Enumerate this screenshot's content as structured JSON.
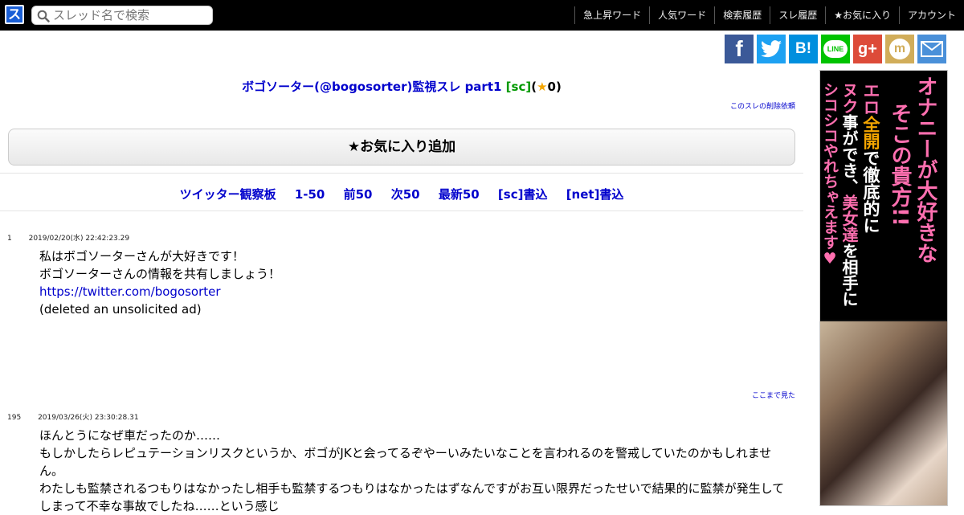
{
  "header": {
    "logo_text": "ス",
    "search_placeholder": "スレッド名で検索",
    "nav": [
      "急上昇ワード",
      "人気ワード",
      "検索履歴",
      "スレ履歴",
      "★お気に入り",
      "アカウント"
    ]
  },
  "share": {
    "icons": [
      "facebook-icon",
      "twitter-icon",
      "hatena-bookmark-icon",
      "line-icon",
      "google-plus-icon",
      "mixi-icon",
      "mail-icon"
    ],
    "labels": {
      "facebook": "f",
      "hatena": "B!",
      "line": "LINE",
      "google": "g+",
      "mixi": "m"
    },
    "colors": [
      "#3b5998",
      "#1da1f2",
      "#008fde",
      "#00c300",
      "#dd4b39",
      "#d1ad5a",
      "#4a90d9"
    ]
  },
  "thread": {
    "title": "ボゴソーター(@bogosorter)監視スレ part1",
    "sc_tag": "[sc]",
    "fav_open": "(",
    "fav_star": "★",
    "fav_count": "0)",
    "delete_request": "このスレの削除依頼",
    "favorite_button": "★お気に入り追加"
  },
  "navlinks": [
    "ツイッター観察板",
    "1-50",
    "前50",
    "次50",
    "最新50",
    "[sc]書込",
    "[net]書込"
  ],
  "posts": [
    {
      "num": "1",
      "datetime": "2019/02/20(水) 22:42:23.29",
      "lines": [
        "私はボゴソーターさんが大好きです！",
        "ボゴソーターさんの情報を共有しましょう！"
      ],
      "link": "https://twitter.com/bogosorter",
      "tail": "(deleted an unsolicited ad)"
    },
    {
      "num": "195",
      "datetime": "2019/03/26(火) 23:30:28.31",
      "lines": [
        "ほんとうになぜ車だったのか……",
        "もしかしたらレピュテーションリスクというか、ボゴがJKと会ってるぞやーいみたいなことを言われるのを警戒していたのかもしれません。",
        "わたしも監禁されるつもりはなかったし相手も監禁するつもりはなかったはずなんですがお互い限界だったせいで結果的に監禁が発生してしまって不幸な事故でしたね……という感じ"
      ]
    }
  ],
  "seen_here": "ここまで見た",
  "ad": {
    "col1": "オナニーが大好きな",
    "col2": "そこの貴方!!",
    "col3_a": "エロ",
    "col3_b": "全開",
    "col3_c": "で徹底的に",
    "col4_a": "ヌク",
    "col4_b": "事ができ、",
    "col4_c": "美女達",
    "col4_d": "を相手に",
    "col5": "シコシコやれちゃえます♥"
  }
}
